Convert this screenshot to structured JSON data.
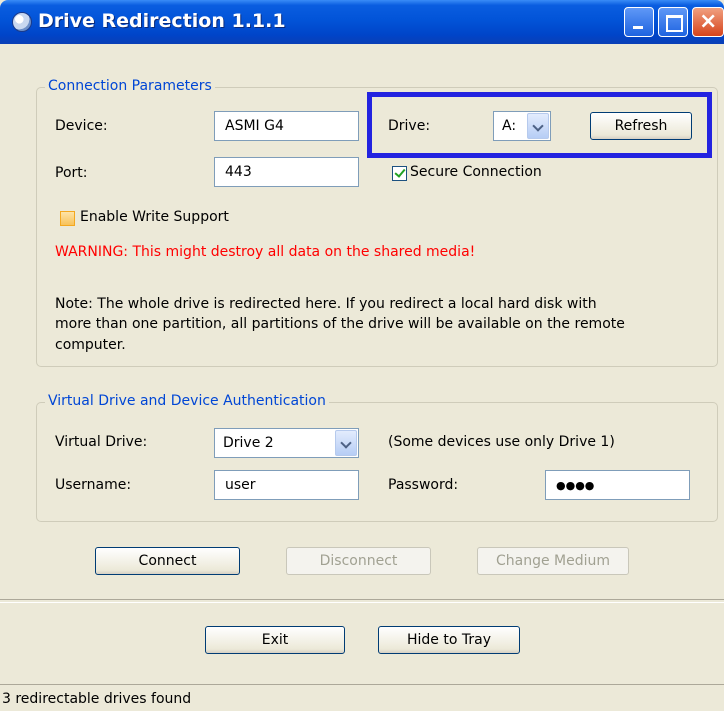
{
  "window": {
    "title": "Drive Redirection 1.1.1",
    "controls": [
      "minimize-icon",
      "maximize-icon",
      "close-icon"
    ]
  },
  "connection": {
    "legend": "Connection Parameters",
    "device_label": "Device:",
    "device_value": "ASMI G4",
    "port_label": "Port:",
    "port_value": "443",
    "drive_label": "Drive:",
    "drive_value": "A:",
    "refresh_label": "Refresh",
    "secure_label": "Secure Connection",
    "secure_checked": true,
    "write_support_label": "Enable Write Support",
    "write_support_checked": false,
    "warning": "WARNING: This might destroy all data on the shared media!",
    "note_line1": "Note: The whole drive is redirected here. If you redirect a local hard disk with",
    "note_line2": "more than one partition, all partitions of the drive will be available on the remote",
    "note_line3": "computer."
  },
  "virtual": {
    "legend": "Virtual Drive and Device Authentication",
    "vdrive_label": "Virtual Drive:",
    "vdrive_value": "Drive 2",
    "vdrive_hint": "(Some devices use only Drive 1)",
    "username_label": "Username:",
    "username_value": "user",
    "password_label": "Password:",
    "password_value": "●●●●"
  },
  "actions": {
    "connect": "Connect",
    "disconnect": "Disconnect",
    "change_medium": "Change Medium",
    "exit": "Exit",
    "hide_to_tray": "Hide to Tray"
  },
  "status": "3 redirectable drives found",
  "colors": {
    "legend": "#0046d5",
    "warning": "#ff0000",
    "highlight": "#2323e0",
    "titlebar": "#0254d8"
  }
}
